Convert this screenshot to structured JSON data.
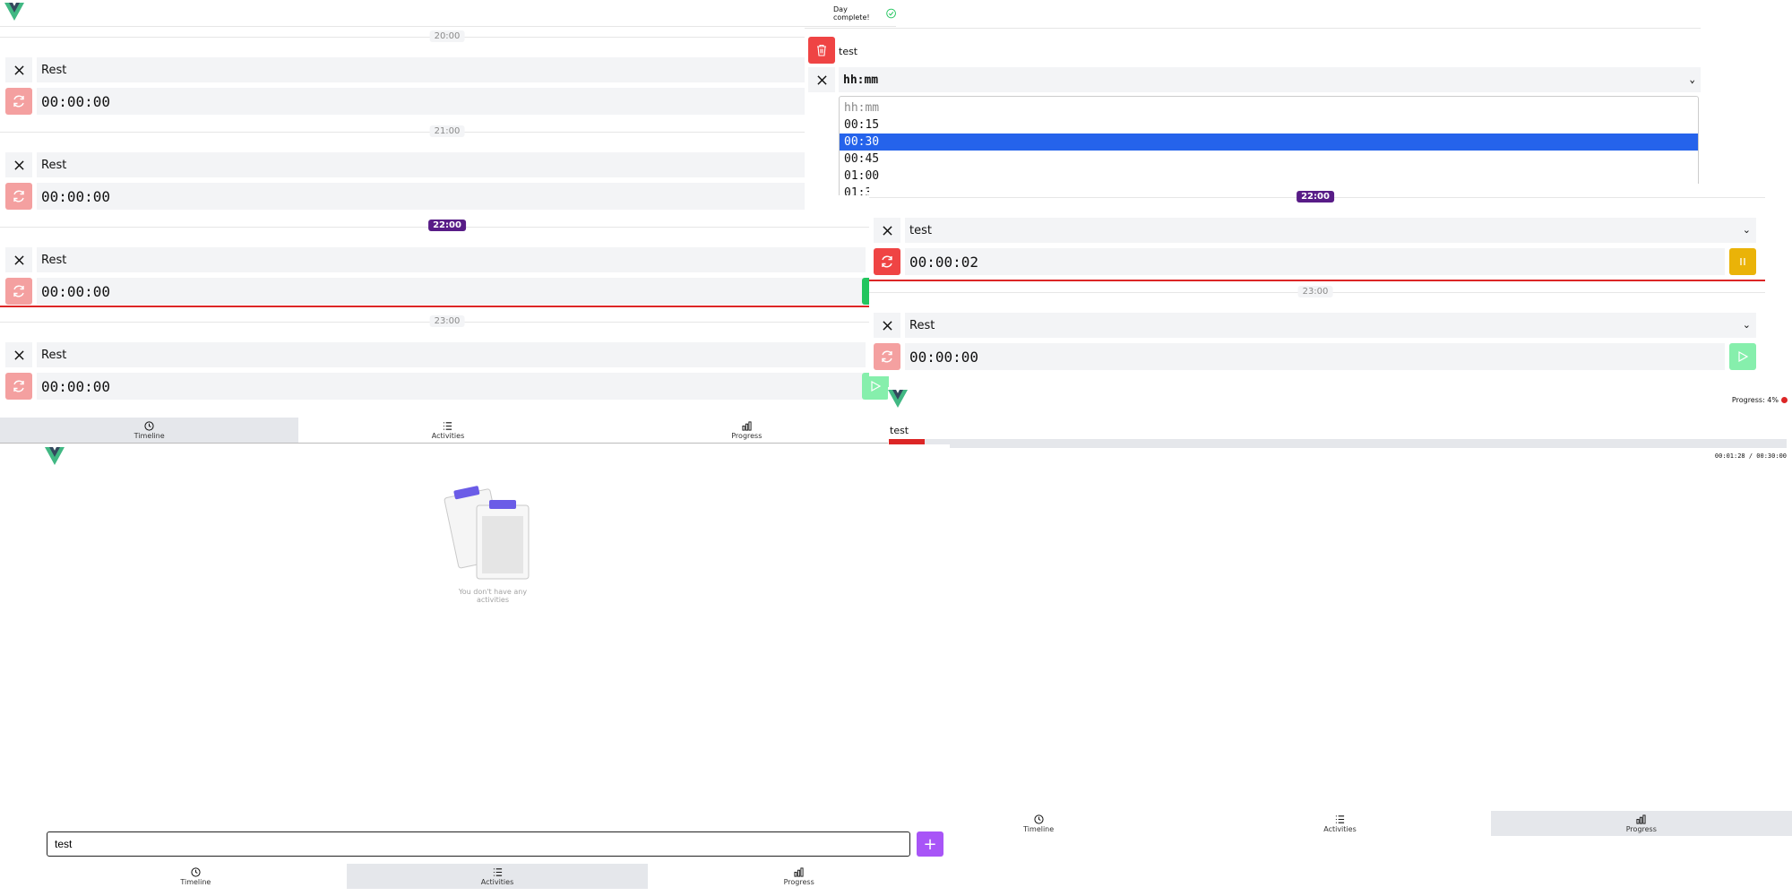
{
  "nav": {
    "timeline": "Timeline",
    "activities": "Activities",
    "progress": "Progress"
  },
  "timeline": {
    "status_text": "Day complete!",
    "rows": [
      {
        "hour": "20:00",
        "activity": "Rest",
        "timer": "00:00:00"
      },
      {
        "hour": "21:00",
        "activity": "Rest",
        "timer": "00:00:00"
      },
      {
        "hour": "22:00",
        "activity": "Rest",
        "timer": "00:00:00"
      },
      {
        "hour": "23:00",
        "activity": "Rest",
        "timer": "00:00:00"
      }
    ]
  },
  "activity_edit": {
    "name": "test",
    "duration_placeholder": "hh:mm",
    "duration_options": [
      "hh:mm",
      "00:15",
      "00:30",
      "00:45",
      "01:00",
      "01:3"
    ],
    "selected_option": "00:30"
  },
  "timeline_zoom": {
    "rows": [
      {
        "hour": "22:00",
        "activity": "test",
        "timer": "00:00:02"
      },
      {
        "hour": "23:00",
        "activity": "Rest",
        "timer": "00:00:00"
      }
    ]
  },
  "progress": {
    "header": "Progress: 4%",
    "items": [
      {
        "name": "test",
        "percent": 4,
        "percent_label": "4%",
        "time": "00:01:28 / 00:30:00"
      }
    ]
  },
  "activities": {
    "empty_text": "You don't have any activities",
    "input_value": "test",
    "add_label": "+"
  },
  "colors": {
    "accent": "#a855f7",
    "danger": "#ef4444",
    "now": "#581c87",
    "play": "#22c55e",
    "pause": "#eab308",
    "progress_fill": "#dc2626"
  }
}
